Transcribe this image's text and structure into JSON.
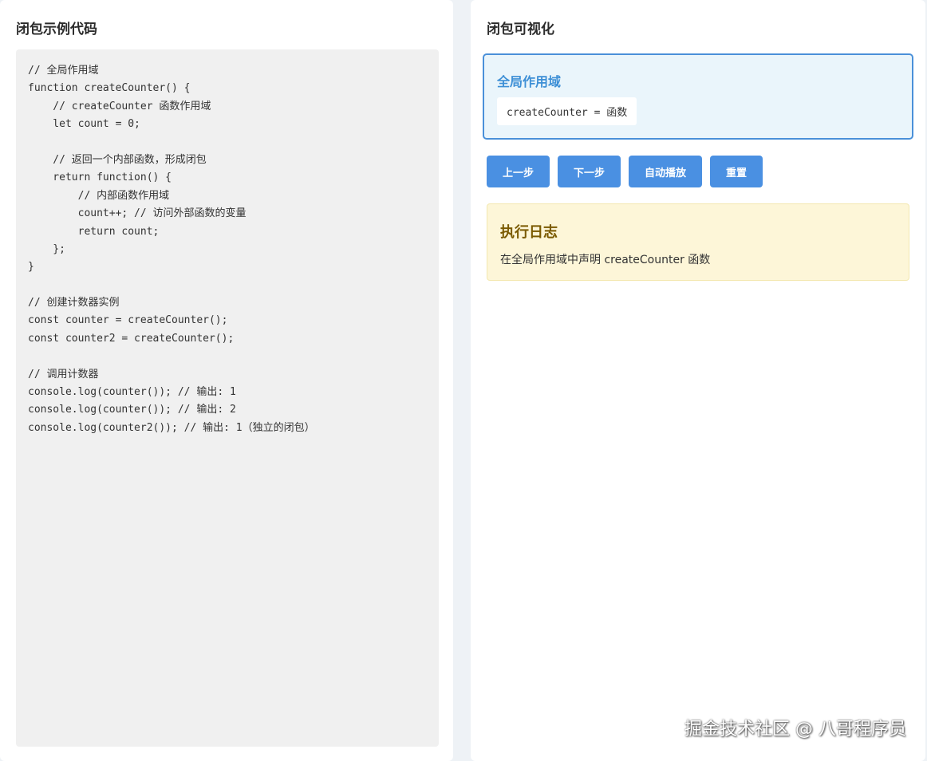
{
  "left_panel": {
    "title": "闭包示例代码",
    "code_lines": [
      "// 全局作用域",
      "function createCounter() {",
      "    // createCounter 函数作用域",
      "    let count = 0;",
      "",
      "    // 返回一个内部函数，形成闭包",
      "    return function() {",
      "        // 内部函数作用域",
      "        count++; // 访问外部函数的变量",
      "        return count;",
      "    };",
      "}",
      "",
      "// 创建计数器实例",
      "const counter = createCounter();",
      "const counter2 = createCounter();",
      "",
      "// 调用计数器",
      "console.log(counter()); // 输出: 1",
      "console.log(counter()); // 输出: 2",
      "console.log(counter2()); // 输出: 1（独立的闭包）"
    ]
  },
  "right_panel": {
    "title": "闭包可视化",
    "scope": {
      "title": "全局作用域",
      "variable": "createCounter = 函数"
    },
    "controls": {
      "prev_label": "上一步",
      "next_label": "下一步",
      "autoplay_label": "自动播放",
      "reset_label": "重置"
    },
    "log": {
      "title": "执行日志",
      "entry": "在全局作用域中声明 createCounter 函数"
    }
  },
  "watermark": "掘金技术社区 @ 八哥程序员",
  "colors": {
    "primary_button": "#4a90e2",
    "scope_border": "#4a90d9",
    "scope_title": "#3d8fd6",
    "log_background": "#fdf6d8",
    "log_title": "#7a5a00"
  }
}
